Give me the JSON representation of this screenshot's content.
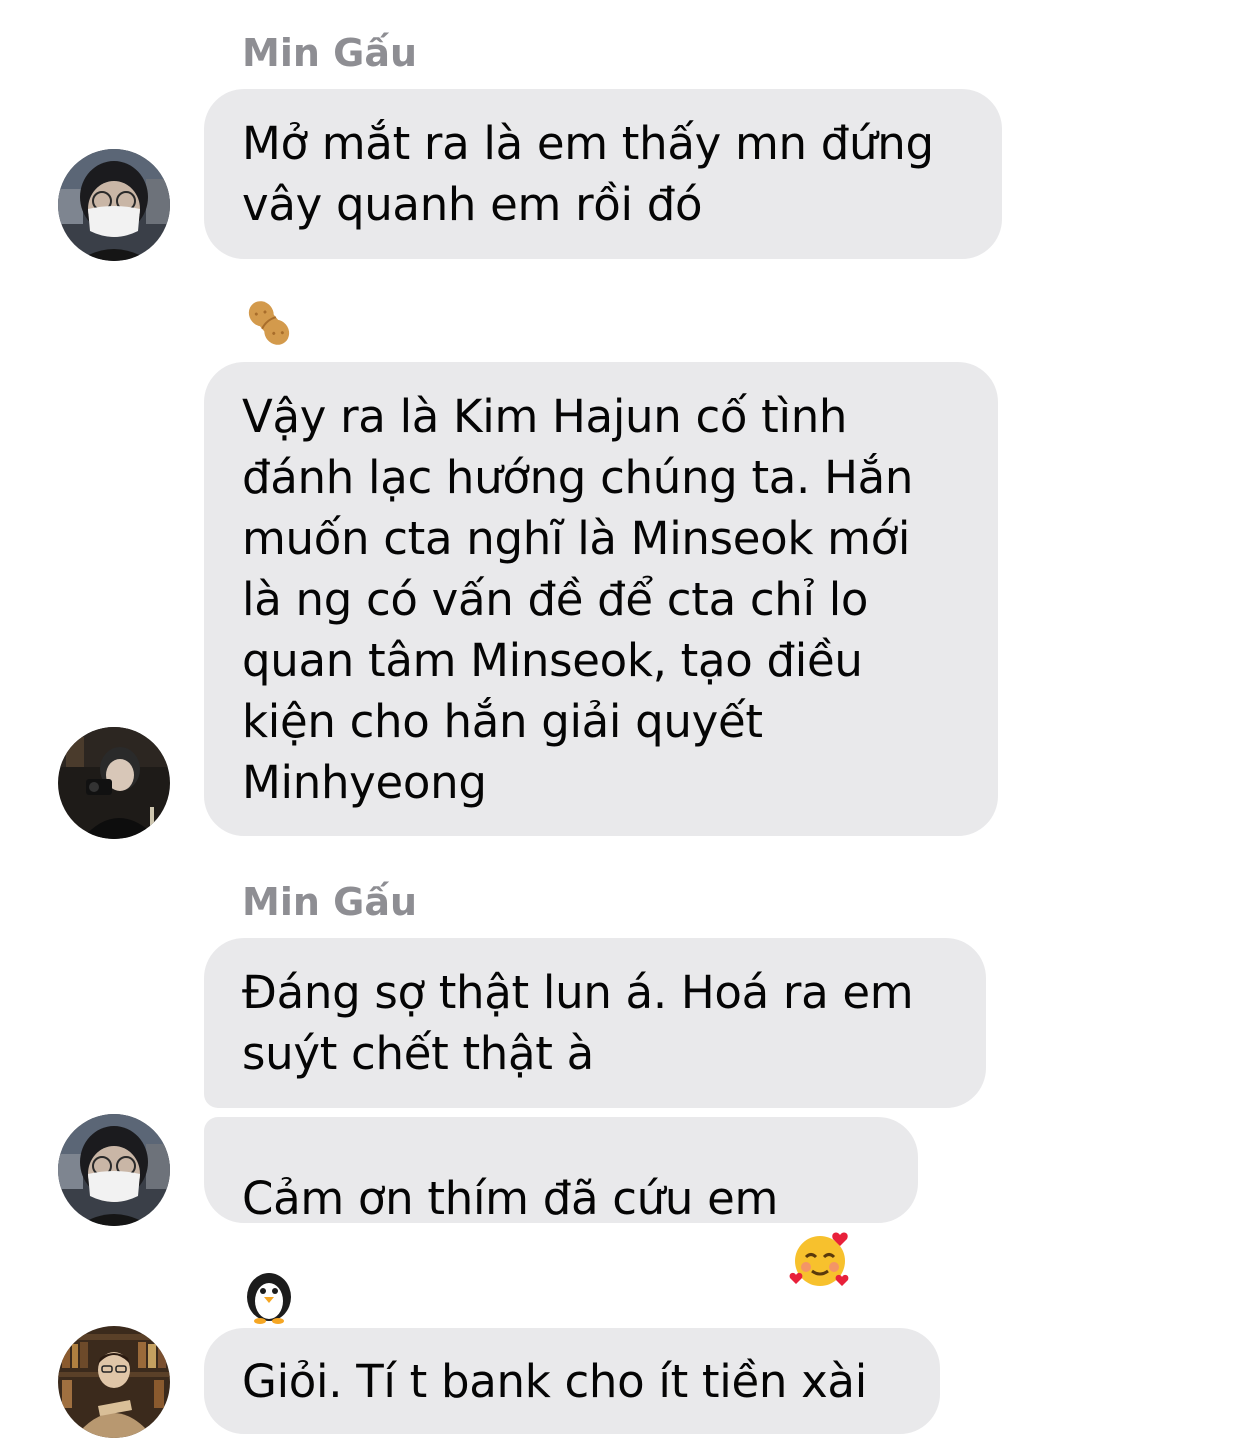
{
  "messages": [
    {
      "sender": "Min Gấu",
      "bubbles": [
        {
          "text": "Mở mắt ra là em thấy mn đứng\nvây quanh em rồi đó"
        }
      ],
      "avatar": "avatar-masked-person"
    },
    {
      "sender_icon": "peanut-icon",
      "bubbles": [
        {
          "text": "Vậy ra là Kim Hajun cố tình\nđánh lạc hướng chúng ta. Hắn\nmuốn cta nghĩ là Minseok mới\nlà ng có vấn đề để cta chỉ lo\nquan tâm Minseok, tạo điều\nkiện cho hắn giải quyết\nMinhyeong"
        }
      ],
      "avatar": "avatar-person-with-camera"
    },
    {
      "sender": "Min Gấu",
      "bubbles": [
        {
          "text": "Đáng sợ thật lun á. Hoá ra em\nsuýt chết thật à"
        },
        {
          "text": "Cảm ơn thím đã cứu em",
          "emoji": "smiling-face-with-hearts-icon"
        }
      ],
      "avatar": "avatar-masked-person"
    },
    {
      "sender_icon": "penguin-icon",
      "bubbles": [
        {
          "text": "Giỏi. Tí t bank cho ít tiền xài"
        }
      ],
      "avatar": "avatar-person-library"
    }
  ],
  "colors": {
    "bubble": "#e9e9eb",
    "sender_name": "#8e8e93",
    "text": "#050505"
  }
}
